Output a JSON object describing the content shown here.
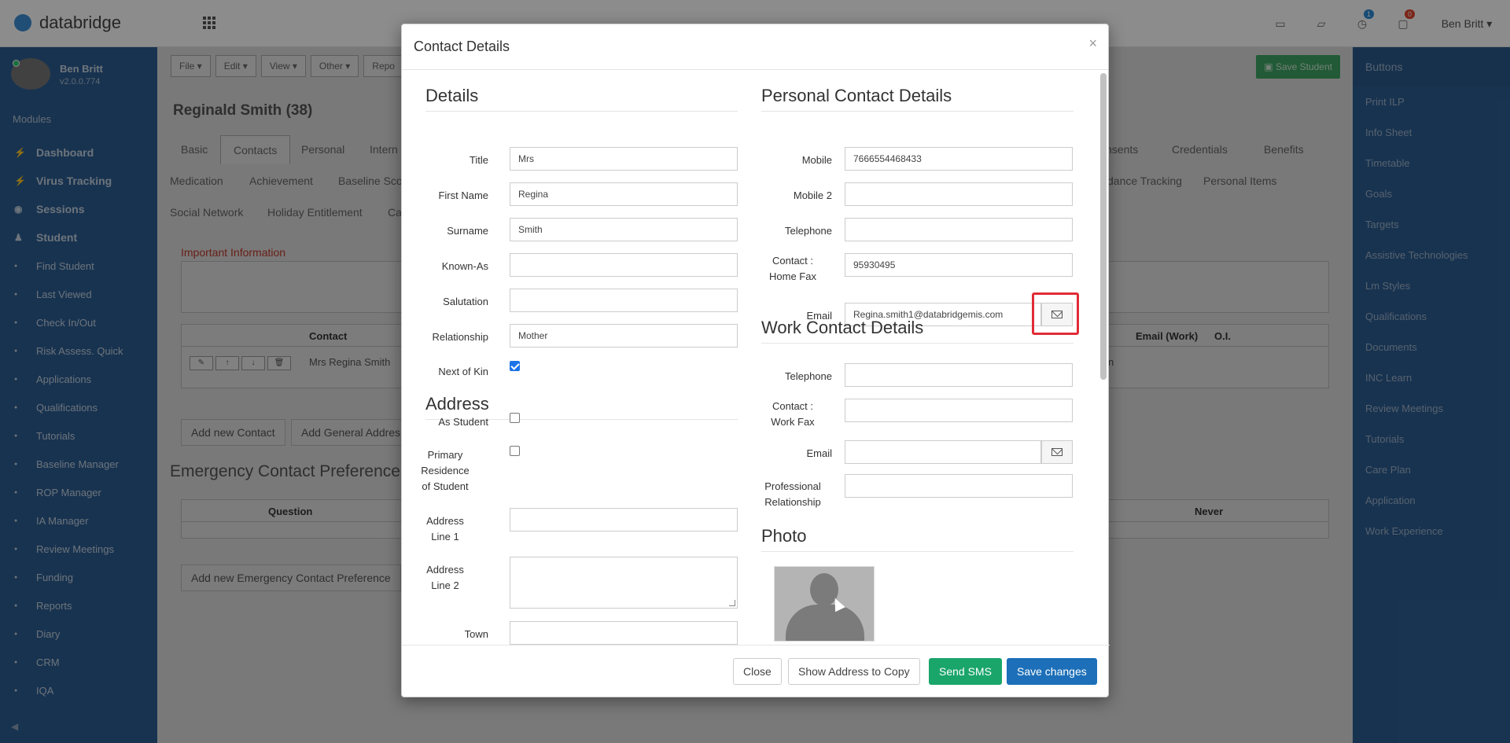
{
  "app": {
    "name": "databridge"
  },
  "topbar": {
    "badge_1": "1",
    "badge_2": "0",
    "user": "Ben Britt"
  },
  "profile": {
    "name": "Ben Britt",
    "version": "v2.0.0.774"
  },
  "sidebar": {
    "modules_label": "Modules",
    "items": [
      {
        "label": "Dashboard",
        "type": "main"
      },
      {
        "label": "Virus Tracking",
        "type": "main"
      },
      {
        "label": "Sessions",
        "type": "main"
      },
      {
        "label": "Student",
        "type": "main"
      },
      {
        "label": "Find Student",
        "type": "sub"
      },
      {
        "label": "Last Viewed",
        "type": "sub"
      },
      {
        "label": "Check In/Out",
        "type": "sub"
      },
      {
        "label": "Risk Assess. Quick",
        "type": "sub"
      },
      {
        "label": "Applications",
        "type": "sub"
      },
      {
        "label": "Qualifications",
        "type": "sub"
      },
      {
        "label": "Tutorials",
        "type": "sub"
      },
      {
        "label": "Baseline Manager",
        "type": "sub"
      },
      {
        "label": "ROP Manager",
        "type": "sub"
      },
      {
        "label": "IA Manager",
        "type": "sub"
      },
      {
        "label": "Review Meetings",
        "type": "sub"
      },
      {
        "label": "Funding",
        "type": "sub"
      },
      {
        "label": "Reports",
        "type": "sub"
      },
      {
        "label": "Diary",
        "type": "sub"
      },
      {
        "label": "CRM",
        "type": "sub"
      },
      {
        "label": "IQA",
        "type": "sub"
      }
    ]
  },
  "toolbar": {
    "file": "File",
    "edit": "Edit",
    "view": "View",
    "other": "Other",
    "report": "Repo",
    "save_student": "Save Student"
  },
  "student": {
    "title": "Reginald Smith (38)"
  },
  "tabs_row1": [
    "Basic",
    "Contacts",
    "Personal",
    "Intern",
    "nsents",
    "Credentials",
    "Benefits"
  ],
  "tabs_row2": [
    "Medication",
    "Achievement",
    "Baseline Scor",
    "dance Tracking",
    "Personal Items"
  ],
  "tabs_row3": [
    "Social Network",
    "Holiday Entitlement",
    "Ca"
  ],
  "important_info": "Important Information",
  "contacts_table": {
    "col_contact": "Contact",
    "col_email_work": "Email (Work)",
    "col_oi": "O.I.",
    "row_name": "Mrs Regina Smith",
    "row_tail": "n"
  },
  "buttons": {
    "add_contact": "Add new Contact",
    "add_general": "Add General Addres",
    "add_emergency": "Add new Emergency Contact Preference"
  },
  "emergency": {
    "title": "Emergency Contact Preference",
    "col_question": "Question",
    "col_never": "Never"
  },
  "right_panel": {
    "header": "Buttons",
    "items": [
      "Print ILP",
      "Info Sheet",
      "Timetable",
      "Goals",
      "Targets",
      "Assistive Technologies",
      "Lm Styles",
      "Qualifications",
      "Documents",
      "INC Learn",
      "Review Meetings",
      "Tutorials",
      "Care Plan",
      "Application",
      "Work Experience"
    ]
  },
  "modal": {
    "title": "Contact Details",
    "close_symbol": "×",
    "details": {
      "heading": "Details",
      "title_label": "Title",
      "title_value": "Mrs",
      "first_name_label": "First Name",
      "first_name_value": "Regina",
      "surname_label": "Surname",
      "surname_value": "Smith",
      "known_as_label": "Known-As",
      "known_as_value": "",
      "salutation_label": "Salutation",
      "salutation_value": "",
      "relationship_label": "Relationship",
      "relationship_value": "Mother",
      "next_of_kin_label": "Next of Kin",
      "next_of_kin_checked": true
    },
    "address": {
      "heading": "Address",
      "as_student_label": "As Student",
      "as_student_checked": false,
      "primary_res_label_1": "Primary",
      "primary_res_label_2": "Residence",
      "primary_res_label_3": "of Student",
      "primary_res_checked": false,
      "line1_label_1": "Address",
      "line1_label_2": "Line 1",
      "line1_value": "",
      "line2_label_1": "Address",
      "line2_label_2": "Line 2",
      "line2_value": "",
      "town_label": "Town",
      "town_value": ""
    },
    "personal": {
      "heading": "Personal Contact Details",
      "mobile_label": "Mobile",
      "mobile_value": "7666554468433",
      "mobile2_label": "Mobile 2",
      "mobile2_value": "",
      "telephone_label": "Telephone",
      "telephone_value": "",
      "home_fax_label_1": "Contact :",
      "home_fax_label_2": "Home Fax",
      "home_fax_value": "95930495",
      "email_label": "Email",
      "email_value": "Regina.smith1@databridgemis.com"
    },
    "work": {
      "heading": "Work Contact Details",
      "telephone_label": "Telephone",
      "telephone_value": "",
      "work_fax_label_1": "Contact :",
      "work_fax_label_2": "Work Fax",
      "work_fax_value": "",
      "email_label": "Email",
      "email_value": "",
      "prof_rel_label_1": "Professional",
      "prof_rel_label_2": "Relationship",
      "prof_rel_value": ""
    },
    "photo": {
      "heading": "Photo"
    },
    "footer": {
      "close": "Close",
      "show_address": "Show Address to Copy",
      "send_sms": "Send SMS",
      "save": "Save changes"
    }
  }
}
